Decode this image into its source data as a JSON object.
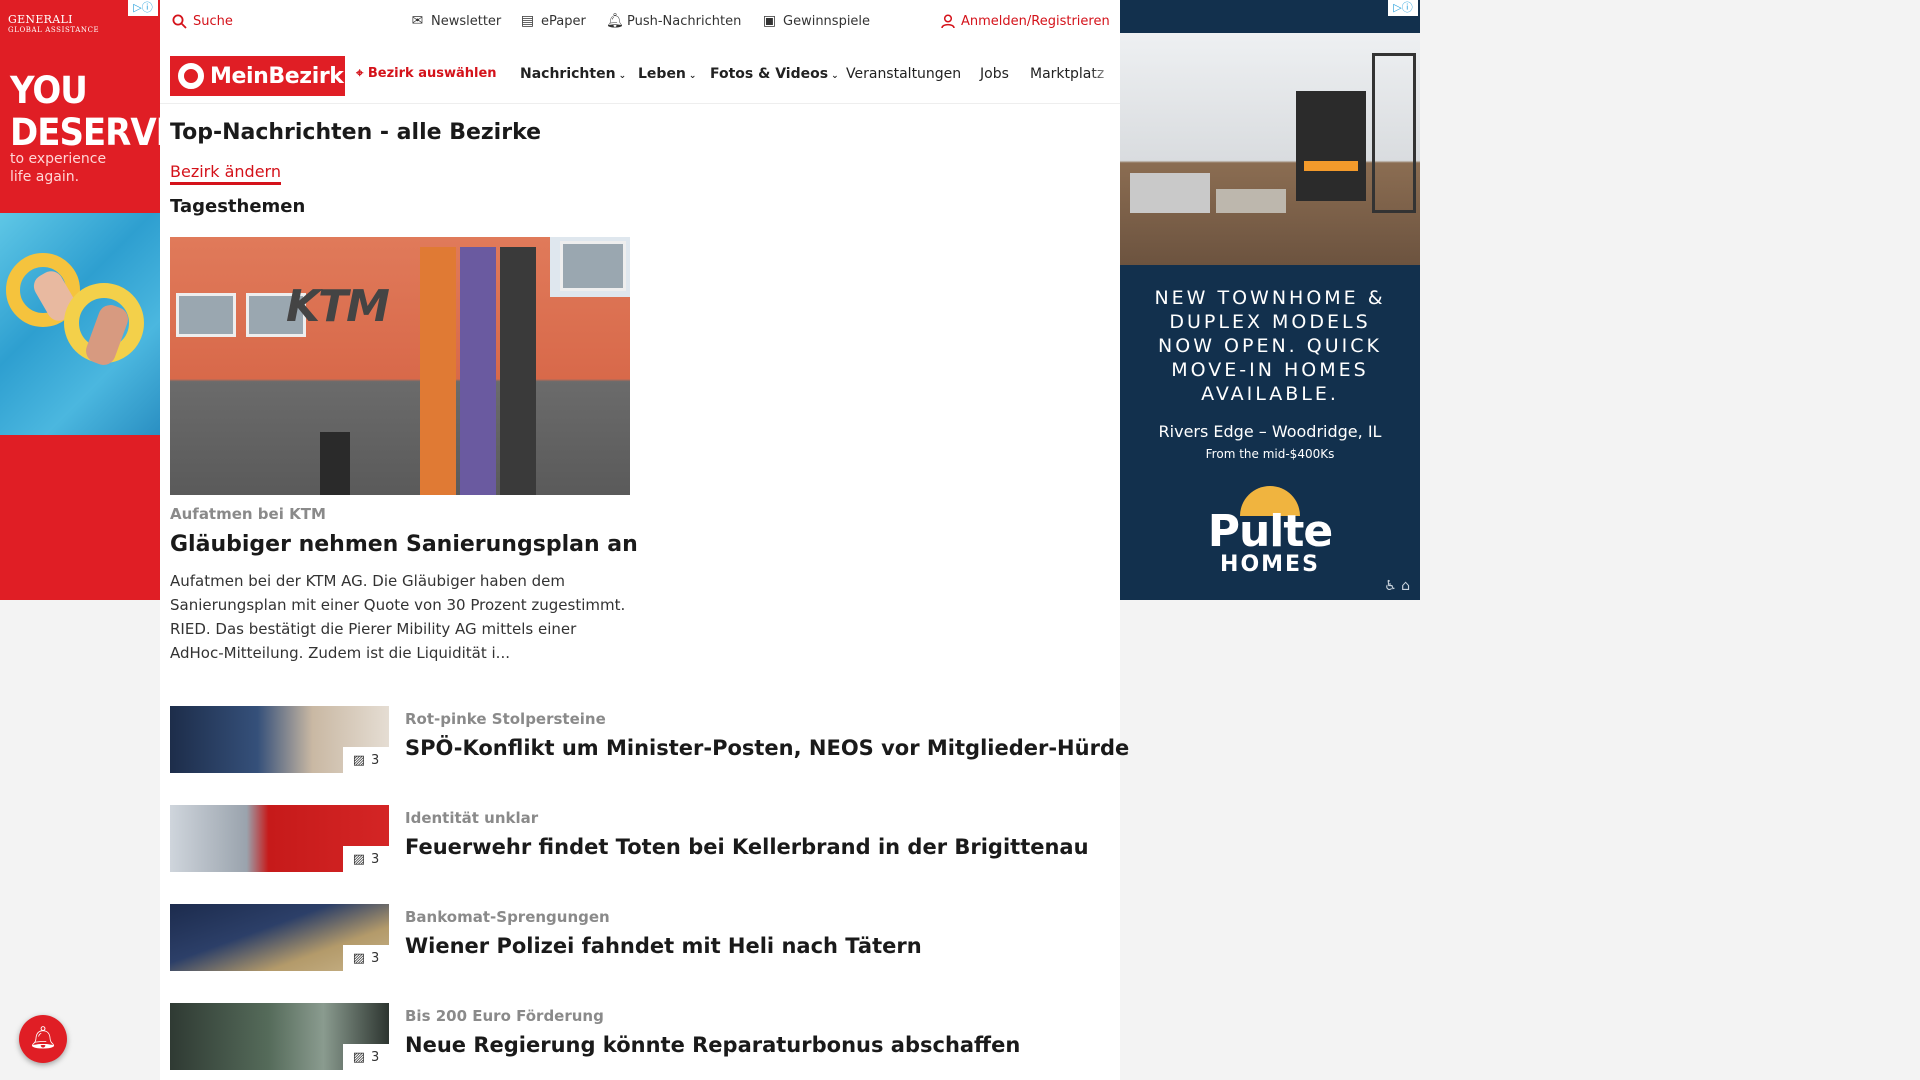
{
  "ad_left": {
    "brand": "GENERALI",
    "brand_sub": "GLOBAL ASSISTANCE",
    "headline": "YOU DESERVE",
    "sub": "to experience life again.",
    "adchoices": "▷ⓘ"
  },
  "ad_right": {
    "headline": "NEW TOWNHOME & DUPLEX MODELS NOW OPEN. QUICK MOVE-IN HOMES AVAILABLE.",
    "location": "Rivers Edge – Woodridge, IL",
    "price": "From the mid-$400Ks",
    "logo_word1": "Pulte",
    "logo_word2": "HOMES",
    "adchoices": "▷ⓘ",
    "ada": "♿ ⌂"
  },
  "topbar": {
    "search": "Suche",
    "newsletter": "Newsletter",
    "epaper": "ePaper",
    "push": "Push-Nachrichten",
    "contests": "Gewinnspiele",
    "login": "Anmelden/Registrieren"
  },
  "nav": {
    "logo": "MeinBezirk",
    "choose_district": "Bezirk auswählen",
    "items": [
      "Nachrichten",
      "Leben",
      "Fotos & Videos",
      "Veranstaltungen",
      "Jobs",
      "Marktplatz"
    ]
  },
  "page": {
    "title": "Top-Nachrichten - alle Bezirke",
    "change_district": "Bezirk ändern",
    "subtitle": "Tagesthemen"
  },
  "hero": {
    "kicker": "Aufatmen bei KTM",
    "title": "Gläubiger nehmen Sanierungsplan an",
    "text": "Aufatmen bei der KTM AG. Die Gläubiger haben dem Sanierungsplan mit einer Quote von 30 Prozent zugestimmt.  RIED. Das bestätigt die Pierer Mibility AG mittels einer AdHoc-Mitteilung. Zudem ist die Liquidität i...",
    "image_text": "KTM"
  },
  "articles": [
    {
      "kicker": "Rot-pinke Stolpersteine",
      "title": "SPÖ-Konflikt um Minister-Posten, NEOS vor Mitglieder-Hürde",
      "count": "3"
    },
    {
      "kicker": "Identität unklar",
      "title": "Feuerwehr findet Toten bei Kellerbrand in der Brigittenau",
      "count": "3"
    },
    {
      "kicker": "Bankomat-Sprengungen",
      "title": "Wiener Polizei fahndet mit Heli nach Tätern",
      "count": "3"
    },
    {
      "kicker": "Bis 200 Euro Förderung",
      "title": "Neue Regierung könnte Reparaturbonus abschaffen",
      "count": "3"
    }
  ],
  "colors": {
    "brand_red": "#e01e25",
    "link_red": "#d4121a",
    "ad_navy": "#12304d"
  },
  "icons": {
    "bell": "bell-icon",
    "search": "search-icon",
    "gallery": "gallery-icon"
  }
}
